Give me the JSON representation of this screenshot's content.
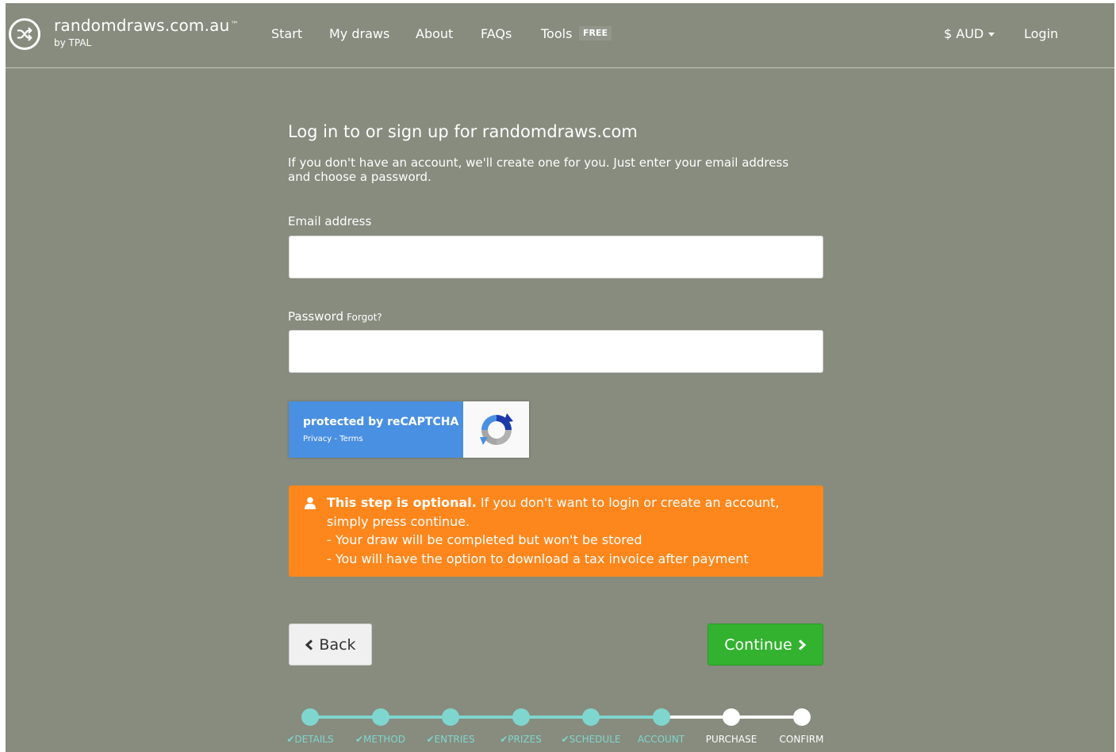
{
  "nav": {
    "brand": "randomdraws.com.au",
    "brand_tm": "™",
    "brand_sub": "by TPAL",
    "items": [
      {
        "label": "Start"
      },
      {
        "label": "My draws"
      },
      {
        "label": "About"
      },
      {
        "label": "FAQs"
      },
      {
        "label": "Tools"
      }
    ],
    "tools_badge": "FREE",
    "currency": "$ AUD",
    "login": "Login"
  },
  "form": {
    "title": "Log in to or sign up for randomdraws.com",
    "description": "If you don't have an account, we'll create one for you. Just enter your email address and choose a password.",
    "email_label": "Email address",
    "email_value": "",
    "password_label": "Password",
    "forgot_label": "Forgot?",
    "password_value": ""
  },
  "recaptcha": {
    "title": "protected by reCAPTCHA",
    "privacy": "Privacy",
    "separator": " - ",
    "terms": "Terms"
  },
  "alert": {
    "bold": "This step is optional.",
    "text": " If you don't want to login or create an account, simply press continue.",
    "line1": "- Your draw will be completed but won't be stored",
    "line2": "- You will have the option to download a tax invoice after payment"
  },
  "buttons": {
    "back": "Back",
    "continue": "Continue"
  },
  "progress": {
    "steps": [
      {
        "label": "DETAILS",
        "done": true,
        "check": "✔"
      },
      {
        "label": "METHOD",
        "done": true,
        "check": "✔"
      },
      {
        "label": "ENTRIES",
        "done": true,
        "check": "✔"
      },
      {
        "label": "PRIZES",
        "done": true,
        "check": "✔"
      },
      {
        "label": "SCHEDULE",
        "done": true,
        "check": "✔"
      },
      {
        "label": "ACCOUNT",
        "done": true,
        "check": ""
      },
      {
        "label": "PURCHASE",
        "done": false,
        "check": ""
      },
      {
        "label": "CONFIRM",
        "done": false,
        "check": ""
      }
    ],
    "done_color": "#7fd6cf",
    "pending_color": "#ffffff"
  },
  "colors": {
    "background": "#878c7e",
    "alert": "#fd871d",
    "continue": "#33b230",
    "recaptcha": "#4a90e2"
  }
}
